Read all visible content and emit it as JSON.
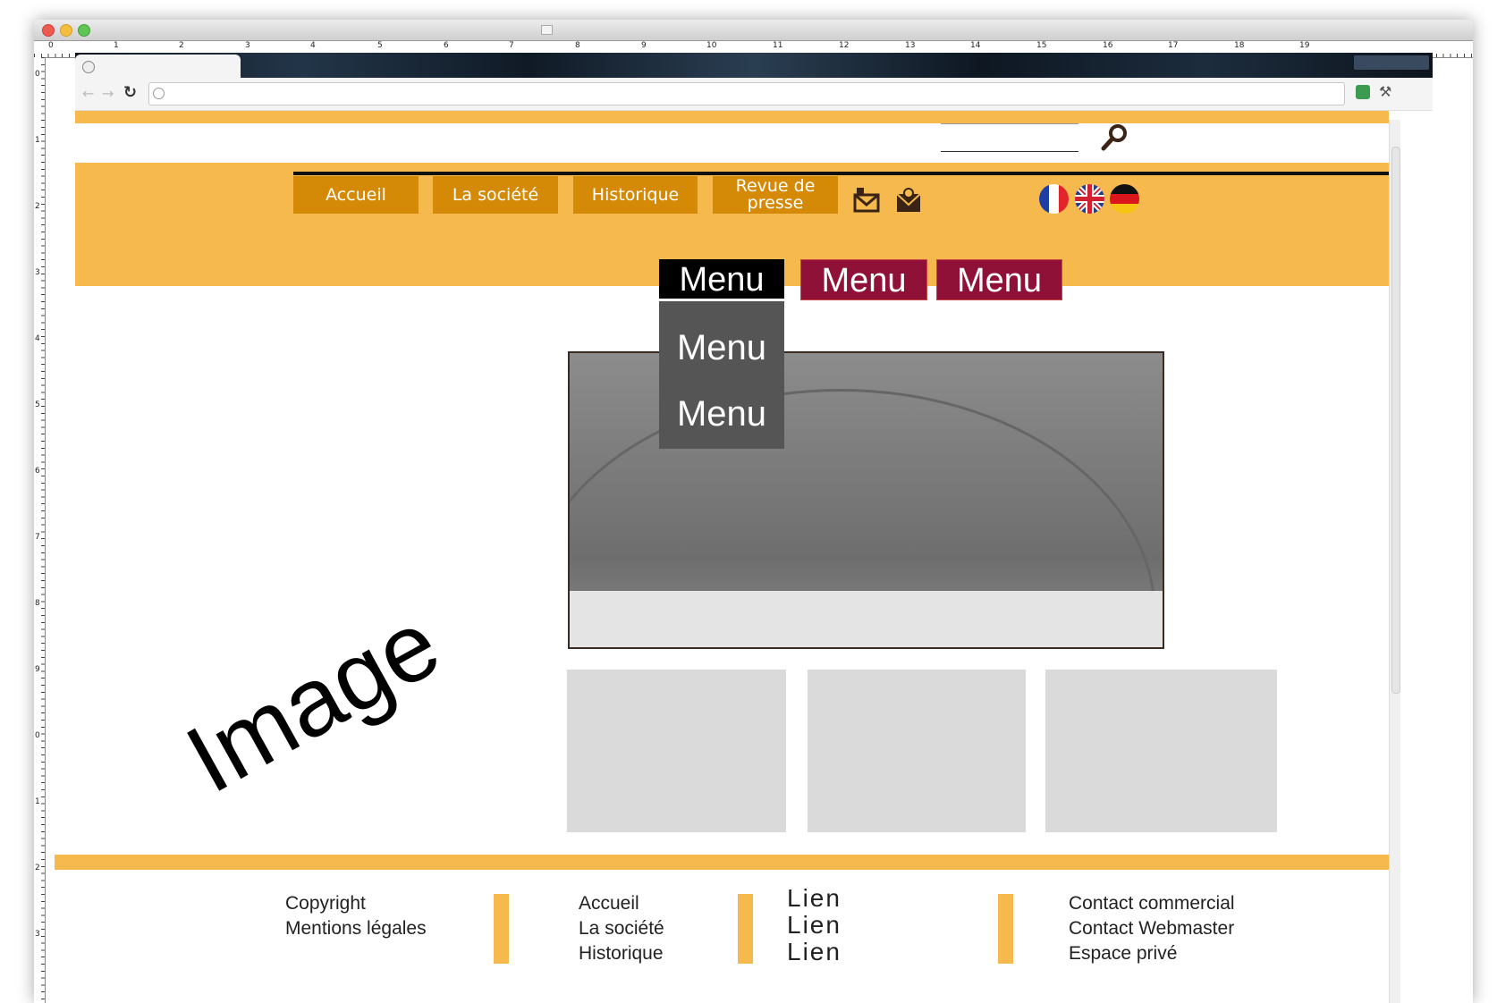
{
  "rulers": {
    "top_ticks": [
      "0",
      "1",
      "2",
      "3",
      "4",
      "5",
      "6",
      "7",
      "8",
      "9",
      "10",
      "11",
      "12",
      "13",
      "14",
      "15",
      "16",
      "17",
      "18",
      "19"
    ],
    "left_ticks": [
      "0",
      "1",
      "2",
      "3",
      "4",
      "5",
      "6",
      "7",
      "8",
      "9",
      "0",
      "1",
      "2",
      "3"
    ]
  },
  "header": {
    "search_placeholder": ""
  },
  "nav": {
    "accueil": "Accueil",
    "societe": "La société",
    "historique": "Historique",
    "revue_line1": "Revue de",
    "revue_line2": "presse"
  },
  "menus": {
    "menu_1": "Menu",
    "menu_2": "Menu",
    "menu_3": "Menu",
    "dropdown": [
      "Menu",
      "Menu"
    ]
  },
  "content": {
    "image_placeholder": "Image"
  },
  "footer": {
    "col1": [
      "Copyright",
      "Mentions légales"
    ],
    "col2": [
      "Accueil",
      "La société",
      "Historique"
    ],
    "col3": [
      "Lien",
      "Lien",
      "Lien"
    ],
    "col4": [
      "Contact commercial",
      "Contact Webmaster",
      "Espace privé"
    ]
  },
  "colors": {
    "band_orange": "#f6b94e",
    "nav_button": "#d48a07",
    "menu_active": "#000000",
    "menu_inactive": "#8f1137",
    "dropdown_bg": "#555555",
    "placeholder_grey": "#dadada"
  },
  "icons": {
    "search": "magnifier",
    "mail": "envelope",
    "email": "at-envelope",
    "flags": [
      "france-flag",
      "uk-flag",
      "germany-flag"
    ]
  }
}
